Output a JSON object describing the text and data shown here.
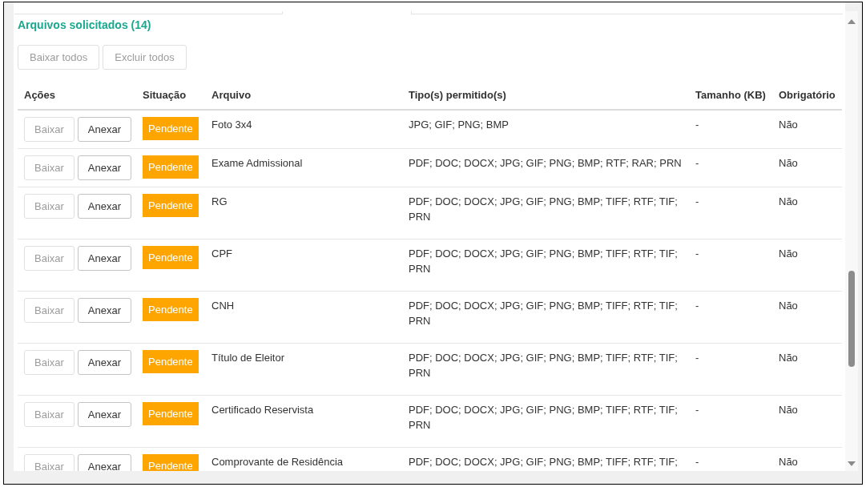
{
  "section": {
    "title": "Arquivos solicitados (14)",
    "buttons": [
      {
        "label": "Baixar todos",
        "disabled": true
      },
      {
        "label": "Excluir todos",
        "disabled": true
      }
    ]
  },
  "table": {
    "columns": [
      "Ações",
      "Situação",
      "Arquivo",
      "Tipo(s) permitido(s)",
      "Tamanho (KB)",
      "Obrigatório"
    ],
    "rows": [
      {
        "actions": [
          {
            "label": "Baixar",
            "disabled": true
          },
          {
            "label": "Anexar",
            "disabled": false
          }
        ],
        "status": {
          "label": "Pendente",
          "color": "#ffa500"
        },
        "file": "Foto 3x4",
        "types": "JPG; GIF; PNG; BMP",
        "size": "-",
        "required": "Não"
      },
      {
        "actions": [
          {
            "label": "Baixar",
            "disabled": true
          },
          {
            "label": "Anexar",
            "disabled": false
          }
        ],
        "status": {
          "label": "Pendente",
          "color": "#ffa500"
        },
        "file": "Exame Admissional",
        "types": "PDF; DOC; DOCX; JPG; GIF; PNG; BMP; RTF; RAR; PRN",
        "size": "-",
        "required": "Não"
      },
      {
        "actions": [
          {
            "label": "Baixar",
            "disabled": true
          },
          {
            "label": "Anexar",
            "disabled": false
          }
        ],
        "status": {
          "label": "Pendente",
          "color": "#ffa500"
        },
        "file": "RG",
        "types": "PDF; DOC; DOCX; JPG; GIF; PNG; BMP; TIFF; RTF; TIF; PRN",
        "size": "-",
        "required": "Não"
      },
      {
        "actions": [
          {
            "label": "Baixar",
            "disabled": true
          },
          {
            "label": "Anexar",
            "disabled": false
          }
        ],
        "status": {
          "label": "Pendente",
          "color": "#ffa500"
        },
        "file": "CPF",
        "types": "PDF; DOC; DOCX; JPG; GIF; PNG; BMP; TIFF; RTF; TIF; PRN",
        "size": "-",
        "required": "Não"
      },
      {
        "actions": [
          {
            "label": "Baixar",
            "disabled": true
          },
          {
            "label": "Anexar",
            "disabled": false
          }
        ],
        "status": {
          "label": "Pendente",
          "color": "#ffa500"
        },
        "file": "CNH",
        "types": "PDF; DOC; DOCX; JPG; GIF; PNG; BMP; TIFF; RTF; TIF; PRN",
        "size": "-",
        "required": "Não"
      },
      {
        "actions": [
          {
            "label": "Baixar",
            "disabled": true
          },
          {
            "label": "Anexar",
            "disabled": false
          }
        ],
        "status": {
          "label": "Pendente",
          "color": "#ffa500"
        },
        "file": "Título de Eleitor",
        "types": "PDF; DOC; DOCX; JPG; GIF; PNG; BMP; TIFF; RTF; TIF; PRN",
        "size": "-",
        "required": "Não"
      },
      {
        "actions": [
          {
            "label": "Baixar",
            "disabled": true
          },
          {
            "label": "Anexar",
            "disabled": false
          }
        ],
        "status": {
          "label": "Pendente",
          "color": "#ffa500"
        },
        "file": "Certificado Reservista",
        "types": "PDF; DOC; DOCX; JPG; GIF; PNG; BMP; TIFF; RTF; TIF; PRN",
        "size": "-",
        "required": "Não"
      },
      {
        "actions": [
          {
            "label": "Baixar",
            "disabled": true
          },
          {
            "label": "Anexar",
            "disabled": false
          }
        ],
        "status": {
          "label": "Pendente",
          "color": "#ffa500"
        },
        "file": "Comprovante de Residência",
        "types": "PDF; DOC; DOCX; JPG; GIF; PNG; BMP; TIFF; RTF; TIF;",
        "size": "-",
        "required": "Não"
      }
    ]
  }
}
